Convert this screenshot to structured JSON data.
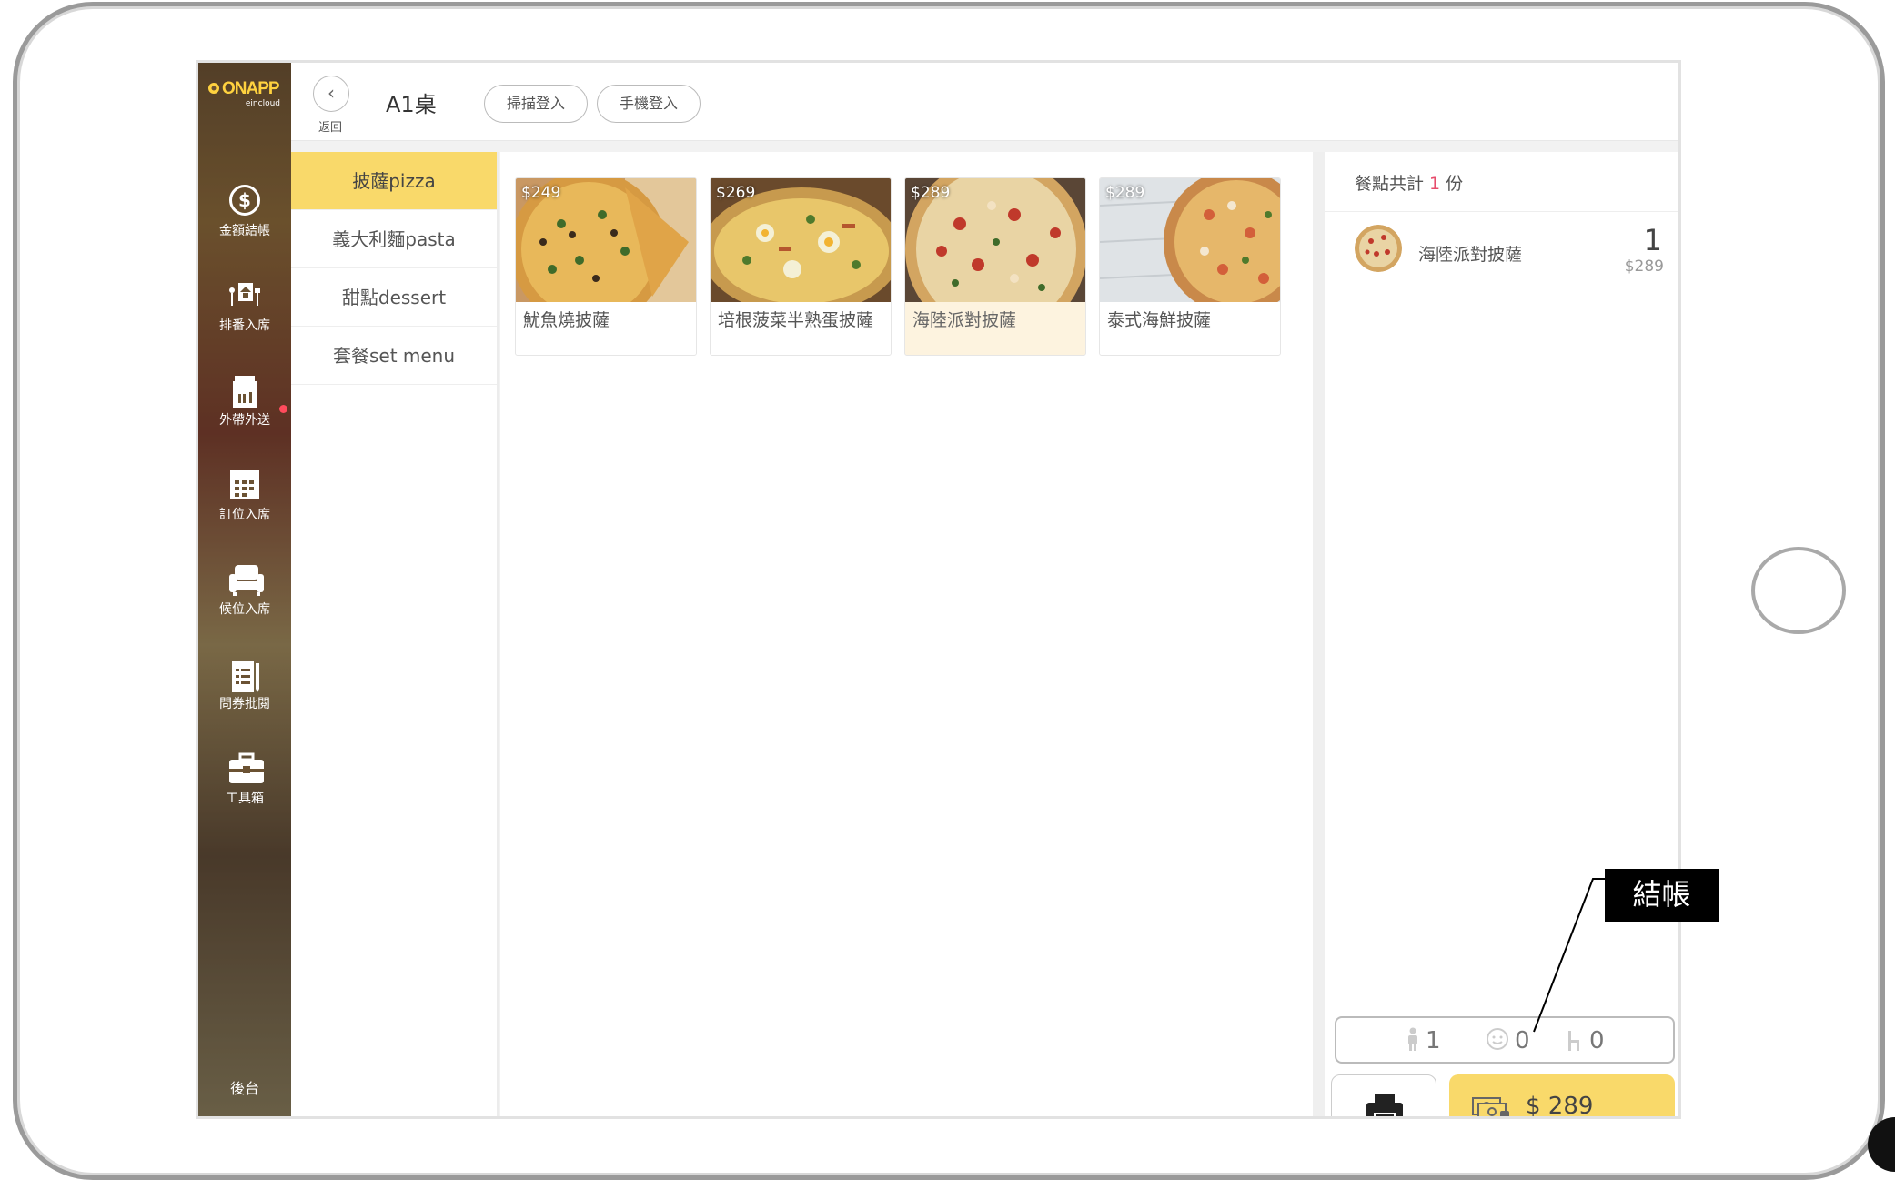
{
  "app": {
    "logo_text": "ONAPP",
    "logo_sub": "eincloud"
  },
  "sidebar": {
    "items": [
      {
        "label": "金額結帳",
        "icon": "dollar-coin-icon"
      },
      {
        "label": "排番入席",
        "icon": "queue-table-icon"
      },
      {
        "label": "外帶外送",
        "icon": "takeout-bag-icon"
      },
      {
        "label": "訂位入席",
        "icon": "calendar-icon"
      },
      {
        "label": "候位入席",
        "icon": "armchair-icon"
      },
      {
        "label": "問券批閱",
        "icon": "survey-clipboard-icon"
      },
      {
        "label": "工具箱",
        "icon": "toolbox-icon"
      }
    ],
    "backend_label": "後台",
    "badge_color": "#ff4b5c"
  },
  "header": {
    "back_label": "返回",
    "table_name": "A1桌",
    "scan_login": "掃描登入",
    "phone_login": "手機登入"
  },
  "categories": [
    {
      "label": "披薩pizza",
      "active": true
    },
    {
      "label": "義大利麵pasta",
      "active": false
    },
    {
      "label": "甜點dessert",
      "active": false
    },
    {
      "label": "套餐set menu",
      "active": false
    }
  ],
  "menu_items": [
    {
      "price": "$249",
      "name": "魷魚燒披薩",
      "selected": false
    },
    {
      "price": "$269",
      "name": "培根菠菜半熟蛋披薩",
      "selected": false
    },
    {
      "price": "$289",
      "name": "海陸派對披薩",
      "selected": true
    },
    {
      "price": "$289",
      "name": "泰式海鮮披薩",
      "selected": false
    }
  ],
  "order": {
    "summary_prefix": "餐點共計",
    "summary_count": "1",
    "summary_suffix": "份",
    "items": [
      {
        "name": "海陸派對披薩",
        "qty": "1",
        "price": "$289"
      }
    ],
    "guests": {
      "adults": "1",
      "children": "0",
      "chairs": "0"
    },
    "total": "$ 289"
  },
  "annotation": {
    "callout_label": "結帳"
  },
  "colors": {
    "accent": "#f9d96a",
    "count_highlight": "#e74c6c"
  }
}
